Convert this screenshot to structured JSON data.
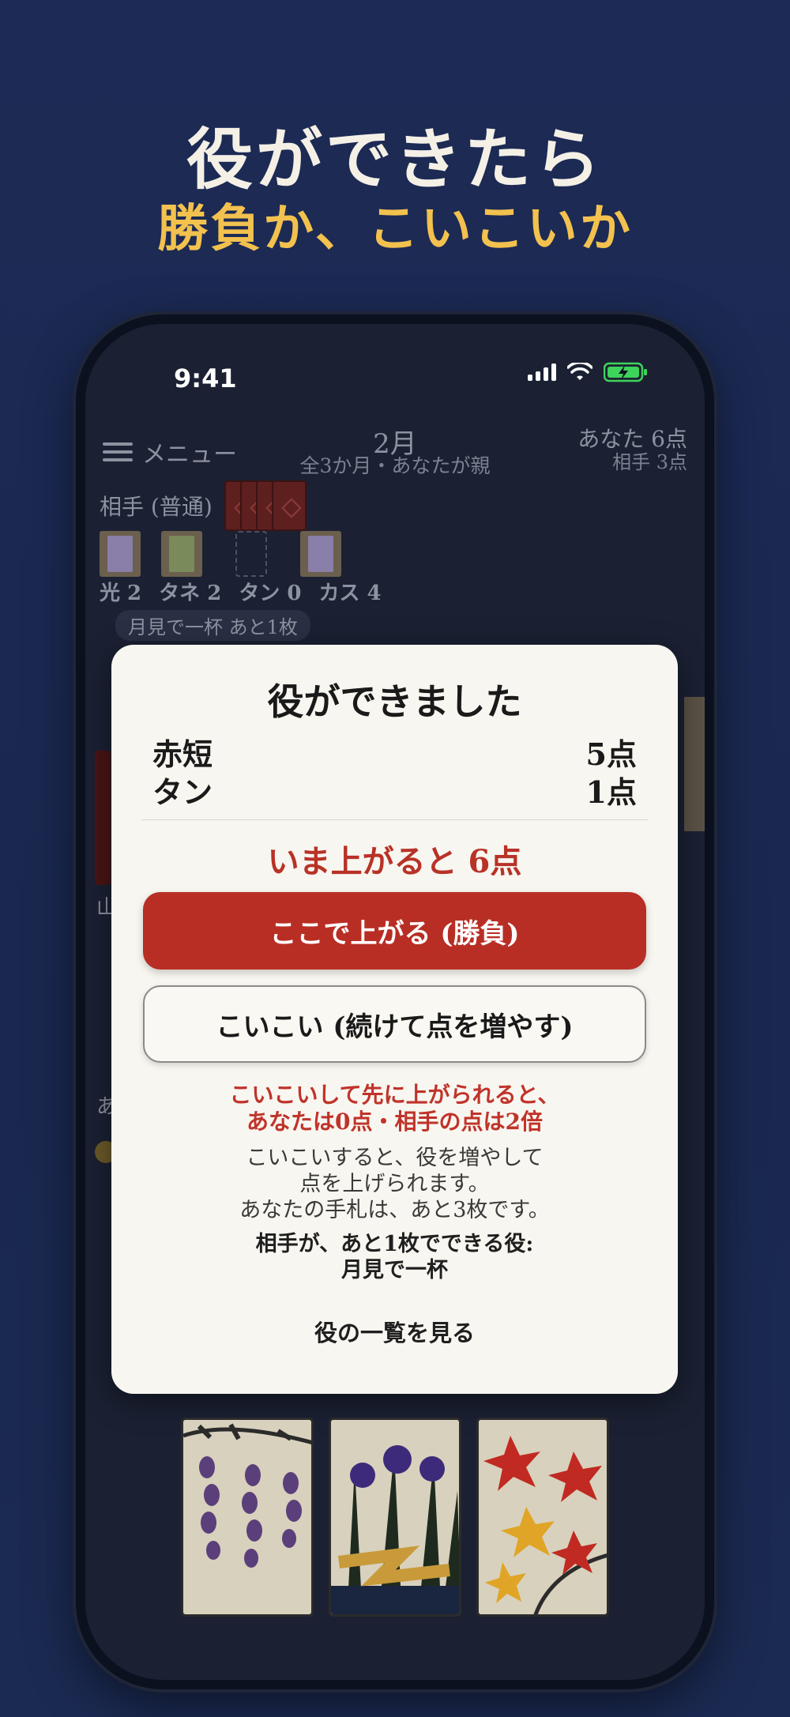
{
  "promo": {
    "headline": "役ができたら",
    "subheadline": "勝負か、こいこいか"
  },
  "status_bar": {
    "time": "9:41"
  },
  "game": {
    "menu_label": "メニュー",
    "month": "2月",
    "round_info": "全3か月・あなたが親",
    "your_score": "あなた 6点",
    "opponent_score": "相手 3点",
    "opponent_label": "相手 (普通)",
    "categories": [
      "光 2",
      "タネ 2",
      "タン 0",
      "カス 4"
    ],
    "hint_pill": "月見で一杯 あと1枚",
    "side_text_1": "山",
    "side_text_2": "あ"
  },
  "dialog": {
    "title": "役ができました",
    "yaku": [
      {
        "name": "赤短",
        "points": "5点"
      },
      {
        "name": "タン",
        "points": "1点"
      }
    ],
    "now_win": "いま上がると 6点",
    "win_button": "ここで上がる (勝負)",
    "koikoi_button": "こいこい (続けて点を増やす)",
    "warning_line1": "こいこいして先に上がられると、",
    "warning_line2": "あなたは0点・相手の点は2倍",
    "info_line1": "こいこいすると、役を増やして",
    "info_line2": "点を上げられます。",
    "info_line3": "あなたの手札は、あと3枚です。",
    "opp_yaku_line1": "相手が、あと1枚でできる役:",
    "opp_yaku_line2": "月見で一杯",
    "yaku_list_link": "役の一覧を見る"
  },
  "hand": {
    "cards": [
      "wisteria-card",
      "iris-card",
      "maple-card"
    ]
  },
  "colors": {
    "accent_gold": "#f2c14e",
    "accent_red": "#b82e25",
    "background_navy": "#1c2a55"
  }
}
